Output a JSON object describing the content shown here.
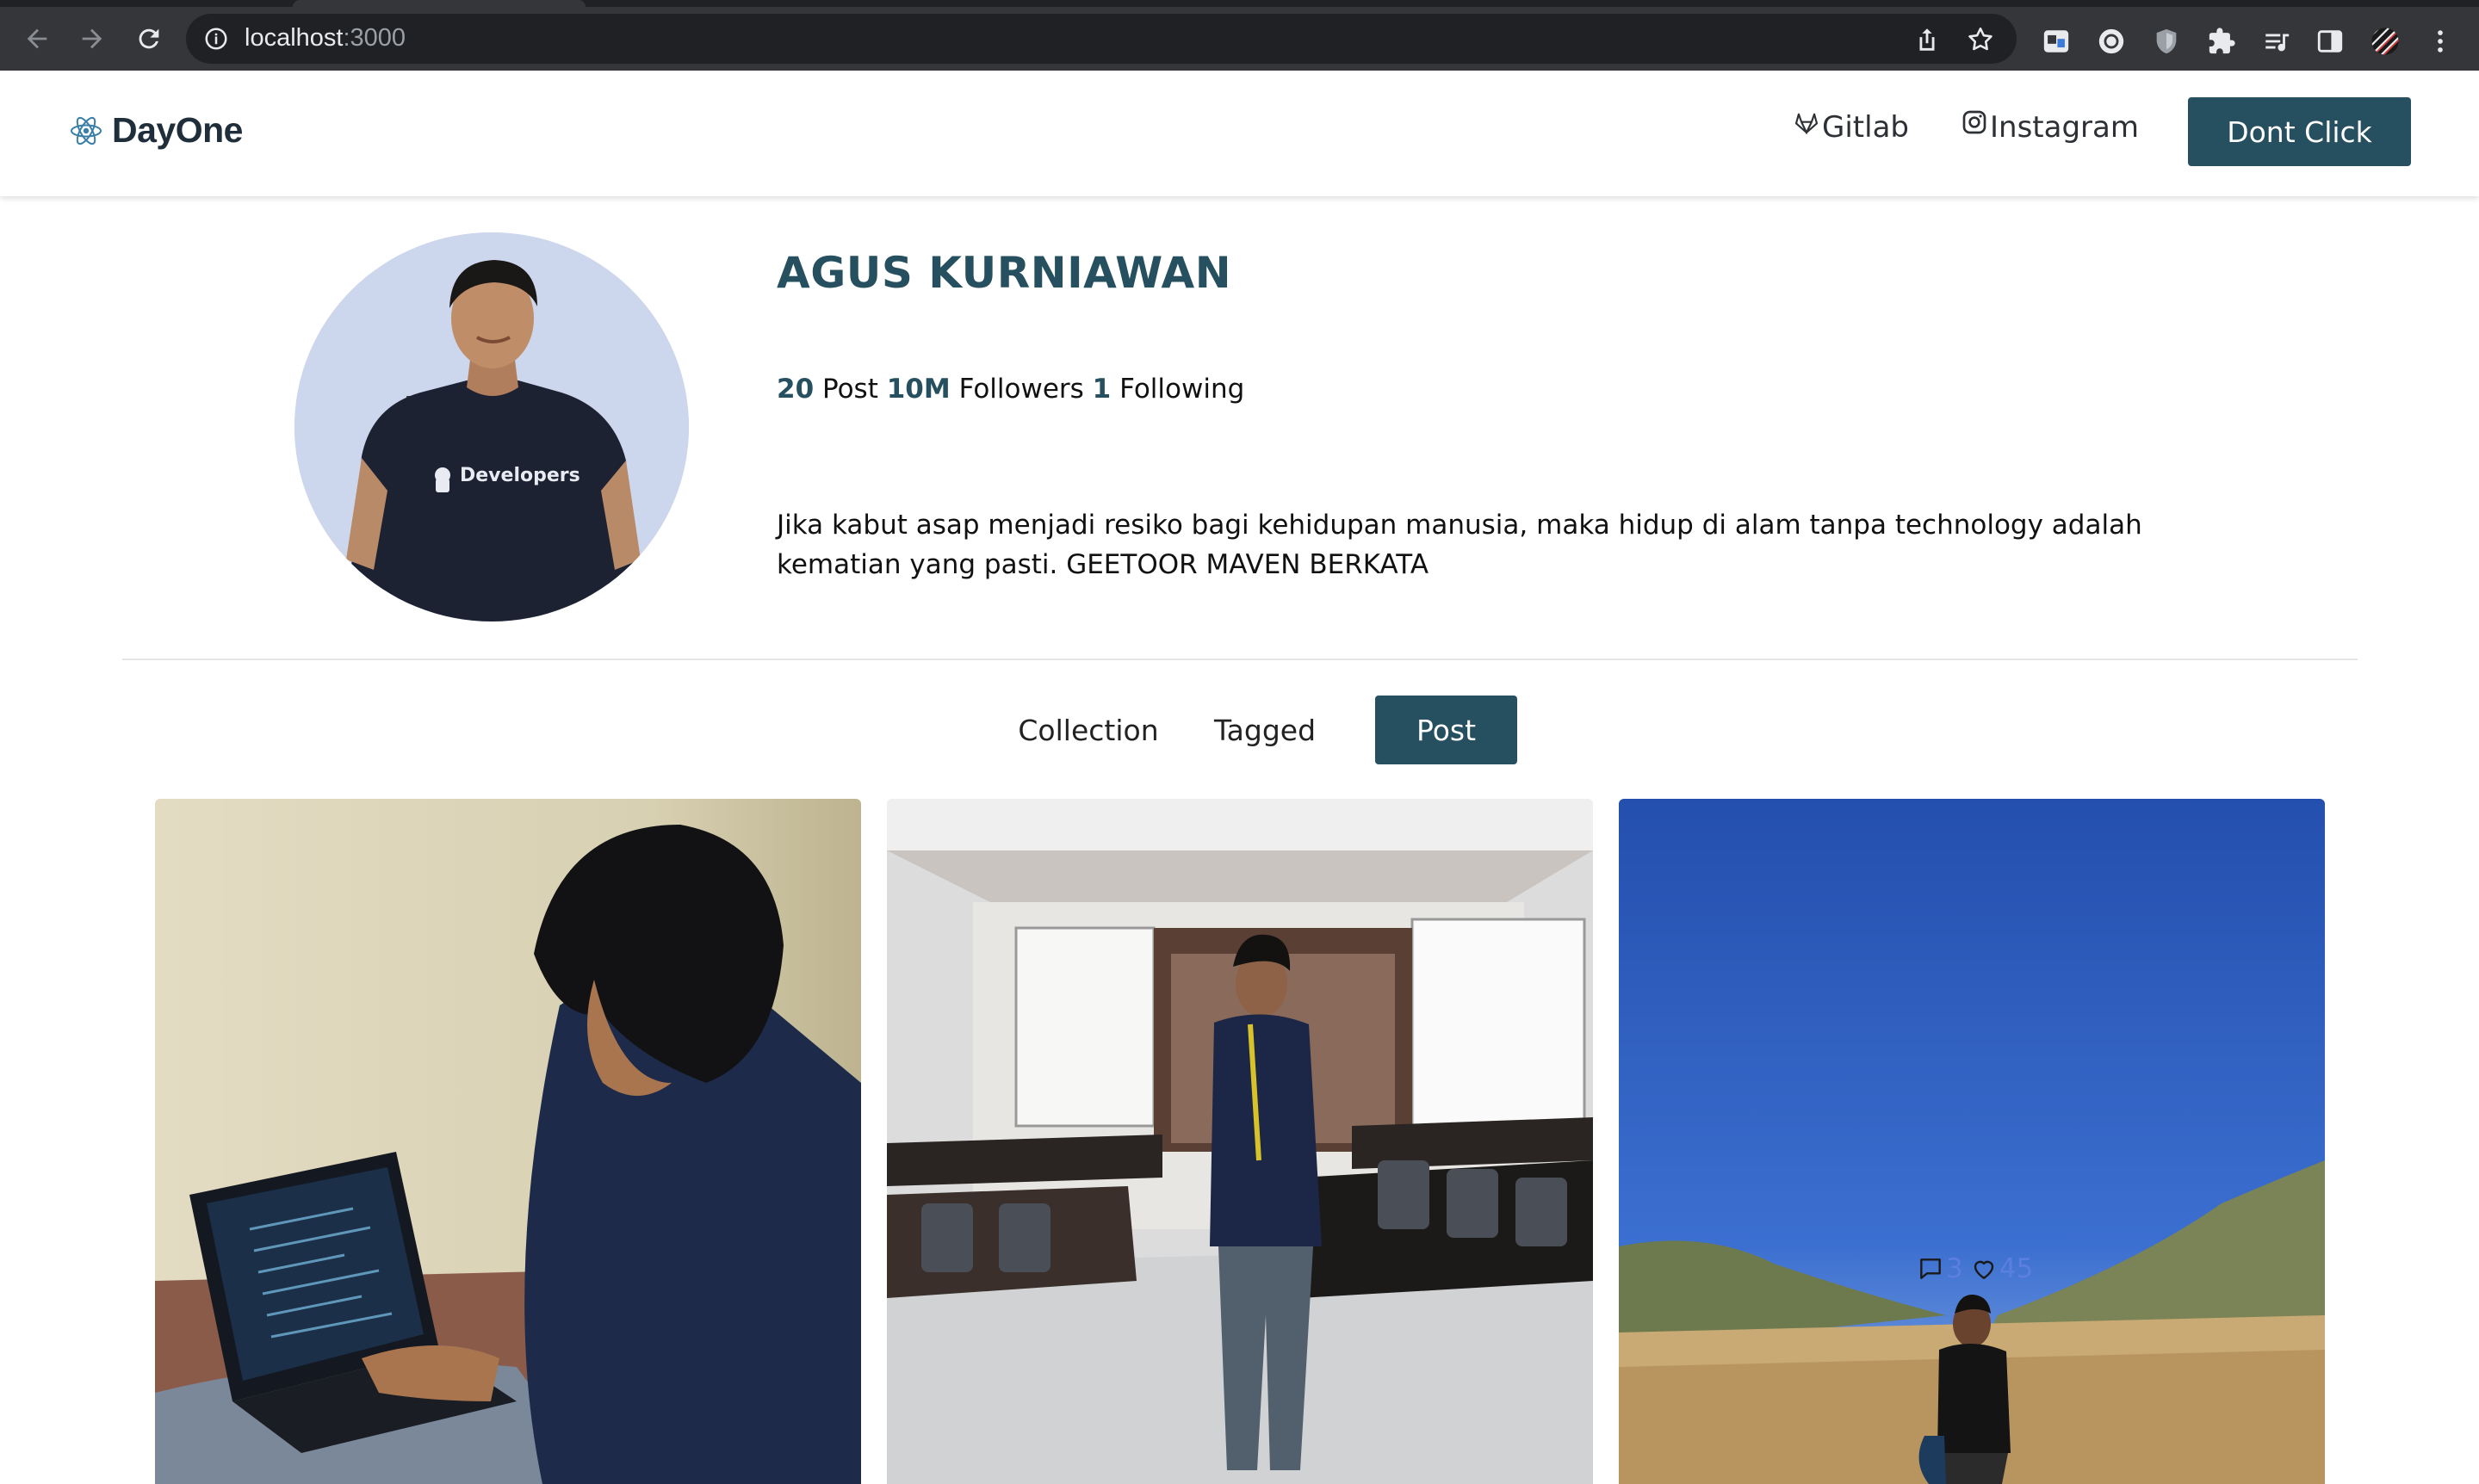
{
  "browser": {
    "url_host": "localhost",
    "url_port": ":3000"
  },
  "navbar": {
    "brand": "DayOne",
    "links": [
      {
        "label": "Gitlab",
        "icon": "gitlab-icon"
      },
      {
        "label": "Instagram",
        "icon": "instagram-icon"
      }
    ],
    "cta_label": "Dont Click",
    "accent_color": "#26505f"
  },
  "profile": {
    "name": "AGUS KURNIAWAN",
    "avatar_shirt_text": "Developers",
    "stats": {
      "posts_count": "20",
      "posts_label": "Post",
      "followers_count": "10M",
      "followers_label": "Followers",
      "following_count": "1",
      "following_label": "Following"
    },
    "bio_line_1": "Jika kabut asap menjadi resiko bagi kehidupan manusia, maka hidup di alam tanpa technology adalah",
    "bio_line_2": "kematian yang pasti. GEETOOR MAVEN BERKATA"
  },
  "tabs": [
    {
      "label": "Collection",
      "active": false
    },
    {
      "label": "Tagged",
      "active": false
    },
    {
      "label": "Post",
      "active": true
    }
  ],
  "posts": [
    {
      "scene": "man coding on laptop",
      "comments": null,
      "likes": null
    },
    {
      "scene": "man on phone in meeting room",
      "comments": null,
      "likes": null
    },
    {
      "scene": "man standing in savanna under blue sky",
      "comments": "3",
      "likes": "45"
    }
  ]
}
